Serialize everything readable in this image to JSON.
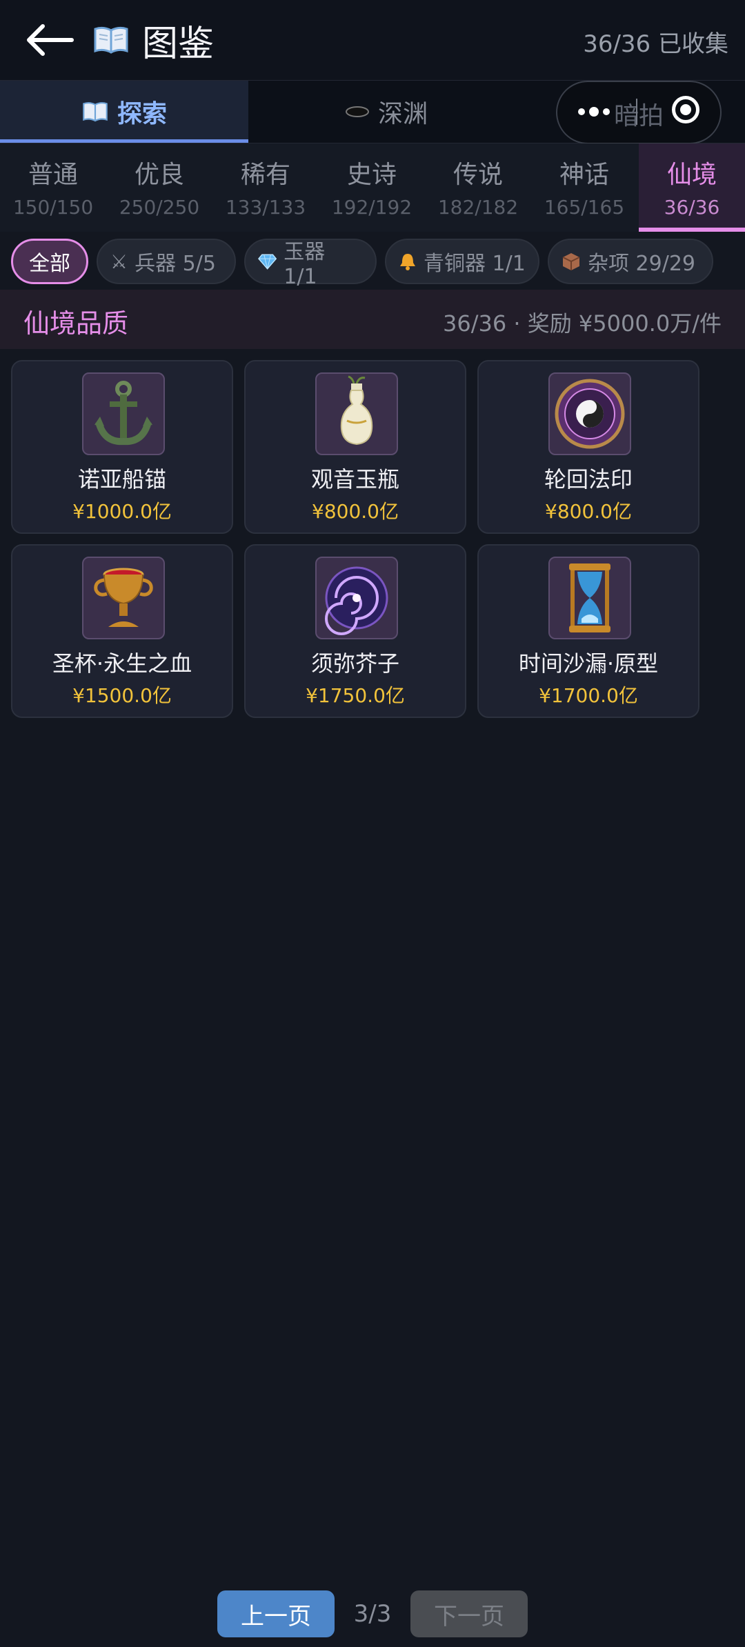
{
  "header": {
    "back_icon": "arrow-left-icon",
    "book_icon": "open-book-icon",
    "title": "图鉴",
    "collected": "36/36 已收集"
  },
  "modes": [
    {
      "label": "探索",
      "icon": "open-book-icon",
      "active": true
    },
    {
      "label": "深渊",
      "icon": "dark-hole-icon",
      "active": false
    }
  ],
  "auction_pill": {
    "label": "暗拍",
    "more_icon": "more-dots-icon",
    "close_icon": "target-circle-icon"
  },
  "rarities": [
    {
      "name": "普通",
      "count": "150/150"
    },
    {
      "name": "优良",
      "count": "250/250"
    },
    {
      "name": "稀有",
      "count": "133/133"
    },
    {
      "name": "史诗",
      "count": "192/192"
    },
    {
      "name": "传说",
      "count": "182/182"
    },
    {
      "name": "神话",
      "count": "165/165"
    },
    {
      "name": "仙境",
      "count": "36/36",
      "active": true
    }
  ],
  "filters": [
    {
      "label": "全部",
      "active": true
    },
    {
      "label": "兵器 5/5",
      "icon": "crossed-swords-icon"
    },
    {
      "label": "玉器 1/1",
      "icon": "gem-icon"
    },
    {
      "label": "青铜器 1/1",
      "icon": "bell-icon"
    },
    {
      "label": "杂项 29/29",
      "icon": "box-icon"
    }
  ],
  "section": {
    "title": "仙境品质",
    "info": "36/36 · 奖励 ¥5000.0万/件"
  },
  "items": [
    {
      "name": "诺亚船锚",
      "price": "¥1000.0亿",
      "icon": "anchor-icon"
    },
    {
      "name": "观音玉瓶",
      "price": "¥800.0亿",
      "icon": "jade-vase-icon"
    },
    {
      "name": "轮回法印",
      "price": "¥800.0亿",
      "icon": "yin-yang-seal-icon"
    },
    {
      "name": "圣杯·永生之血",
      "price": "¥1500.0亿",
      "icon": "holy-grail-icon"
    },
    {
      "name": "须弥芥子",
      "price": "¥1750.0亿",
      "icon": "galaxy-orb-icon"
    },
    {
      "name": "时间沙漏·原型",
      "price": "¥1700.0亿",
      "icon": "hourglass-icon"
    }
  ],
  "pager": {
    "prev": "上一页",
    "indicator": "3/3",
    "next": "下一页"
  },
  "colors": {
    "accent_pink": "#e58ee8",
    "price_gold": "#f2c33b",
    "explore_blue": "#8fb8ff",
    "prev_button": "#4d86c9"
  }
}
